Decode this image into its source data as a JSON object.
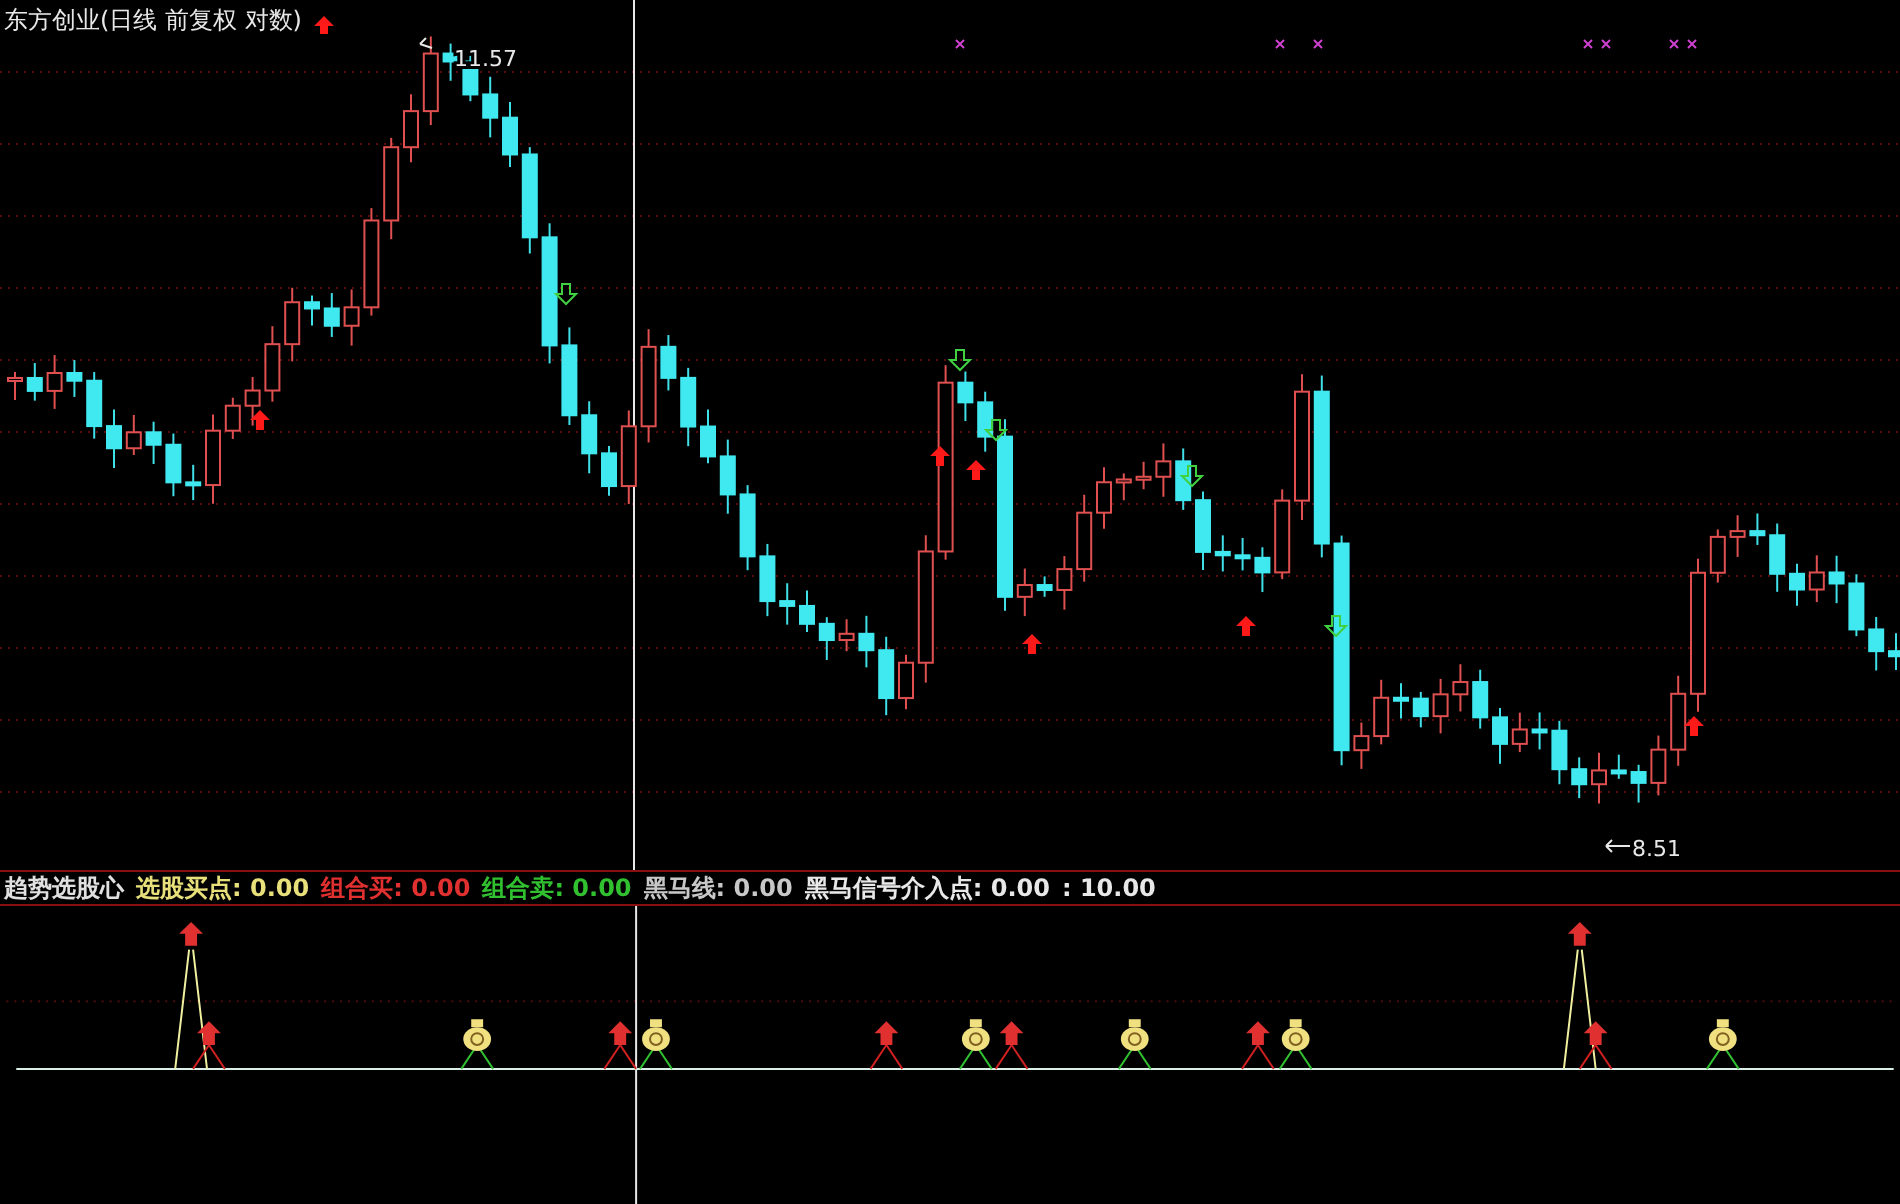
{
  "chart_title": "东方创业(日线 前复权 对数)",
  "price_labels": {
    "high": "11.57",
    "low": "8.51"
  },
  "indicator_legend": [
    {
      "text": "趋势选股心",
      "color": "#e0e0e0"
    },
    {
      "text": "选股买点: 0.00",
      "color": "#e8e07a"
    },
    {
      "text": "组合买: 0.00",
      "color": "#e03030"
    },
    {
      "text": "组合卖: 0.00",
      "color": "#30c030"
    },
    {
      "text": "黑马线: 0.00",
      "color": "#c8c8c8"
    },
    {
      "text": "黑马信号介入点: 0.00",
      "color": "#e8e8e8"
    },
    {
      "text": ": 10.00",
      "color": "#e8e8e8"
    }
  ]
}
